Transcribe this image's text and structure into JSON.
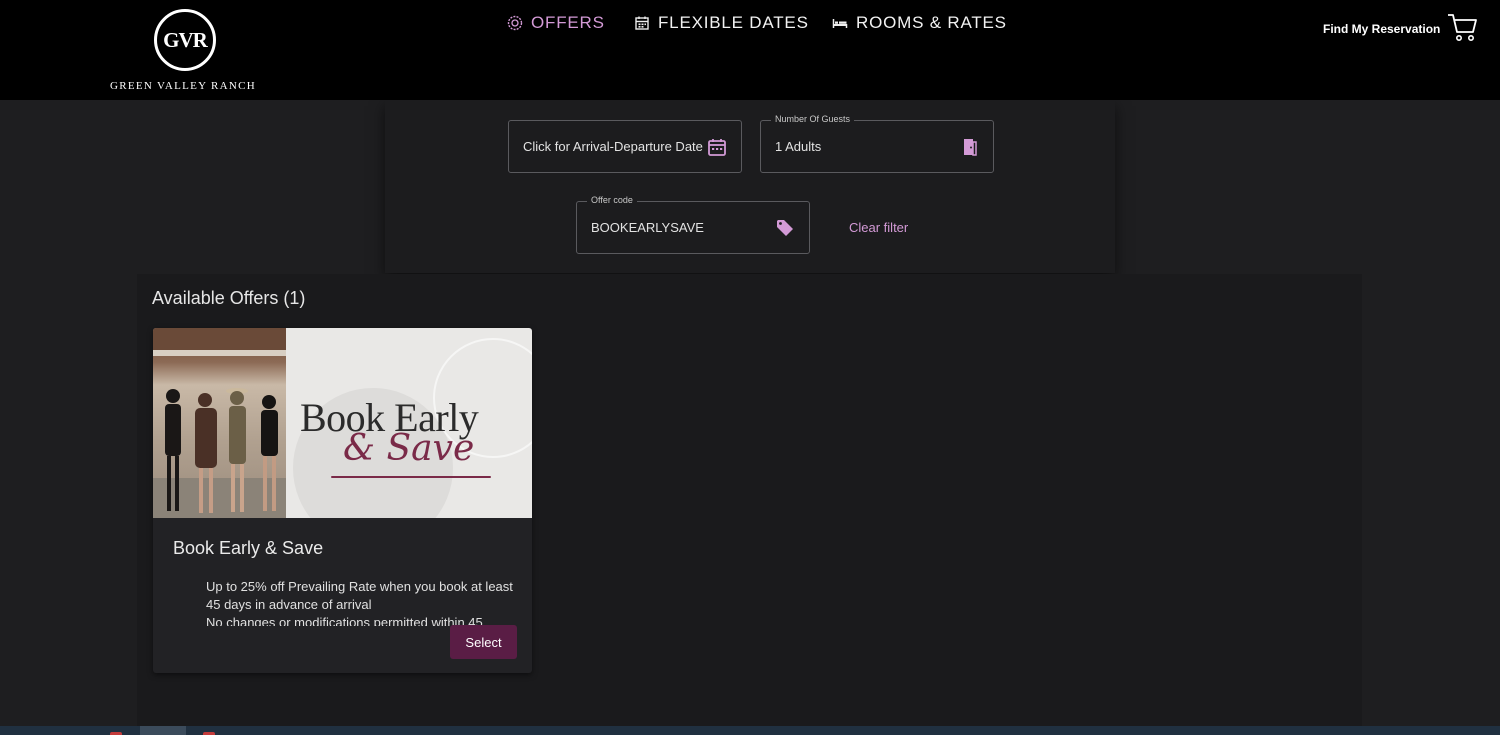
{
  "header": {
    "logo_monogram": "GVR",
    "logo_text": "GREEN VALLEY RANCH",
    "nav": [
      {
        "label": "OFFERS",
        "icon": "offers-badge-icon",
        "active": true
      },
      {
        "label": "FLEXIBLE DATES",
        "icon": "calendar-icon",
        "active": false
      },
      {
        "label": "ROOMS & RATES",
        "icon": "bed-icon",
        "active": false
      }
    ],
    "find_reservation": "Find My Reservation",
    "cart_icon": "shopping-cart-icon"
  },
  "search": {
    "dates": {
      "value": "Click for Arrival-Departure Date",
      "icon": "calendar-icon"
    },
    "guests": {
      "legend": "Number Of Guests",
      "value": "1 Adults",
      "icon": "door-icon"
    },
    "offer_code": {
      "legend": "Offer code",
      "value": "BOOKEARLYSAVE",
      "icon": "tag-icon"
    },
    "clear_filter": "Clear filter"
  },
  "offers": {
    "title": "Available Offers (1)",
    "cards": [
      {
        "image_headline": "Book Early",
        "image_script": "& Save",
        "title": "Book Early & Save",
        "bullets": [
          "Up to 25% off Prevailing Rate when you book at least 45 days in advance of arrival",
          "No changes or modifications permitted within 45"
        ],
        "select_label": "Select"
      }
    ]
  },
  "colors": {
    "accent": "#d39ad6",
    "button": "#5a1d45",
    "header_bg": "#000000",
    "page_bg": "#1e1e20"
  }
}
